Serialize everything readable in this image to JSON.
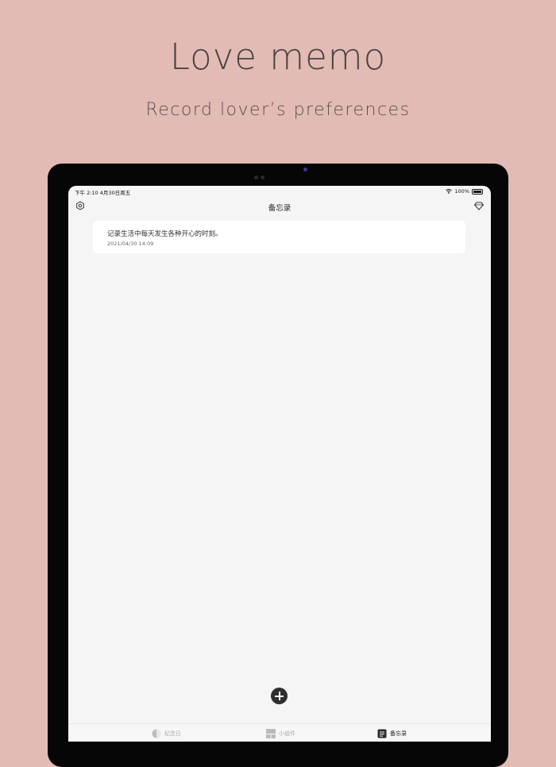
{
  "promo": {
    "title": "Love memo",
    "subtitle": "Record lover’s preferences"
  },
  "status_bar": {
    "time_date": "下午 2:10   4月30日周五",
    "battery": "100%"
  },
  "nav": {
    "title": "备忘录",
    "left_icon": "settings-icon",
    "right_icon": "diamond-icon"
  },
  "memos": [
    {
      "text": "记录生活中每天发生各种开心的时刻。",
      "date": "2021/04/30 14:09"
    }
  ],
  "add_icon": "plus-icon",
  "tabs": [
    {
      "label": "纪念日",
      "icon": "anniversary-icon",
      "active": false
    },
    {
      "label": "小组件",
      "icon": "widget-icon",
      "active": false
    },
    {
      "label": "备忘录",
      "icon": "memo-icon",
      "active": true
    }
  ],
  "colors": {
    "background": "#e2bbb5",
    "screen": "#f5f5f5",
    "accent": "#2f2f2f"
  }
}
